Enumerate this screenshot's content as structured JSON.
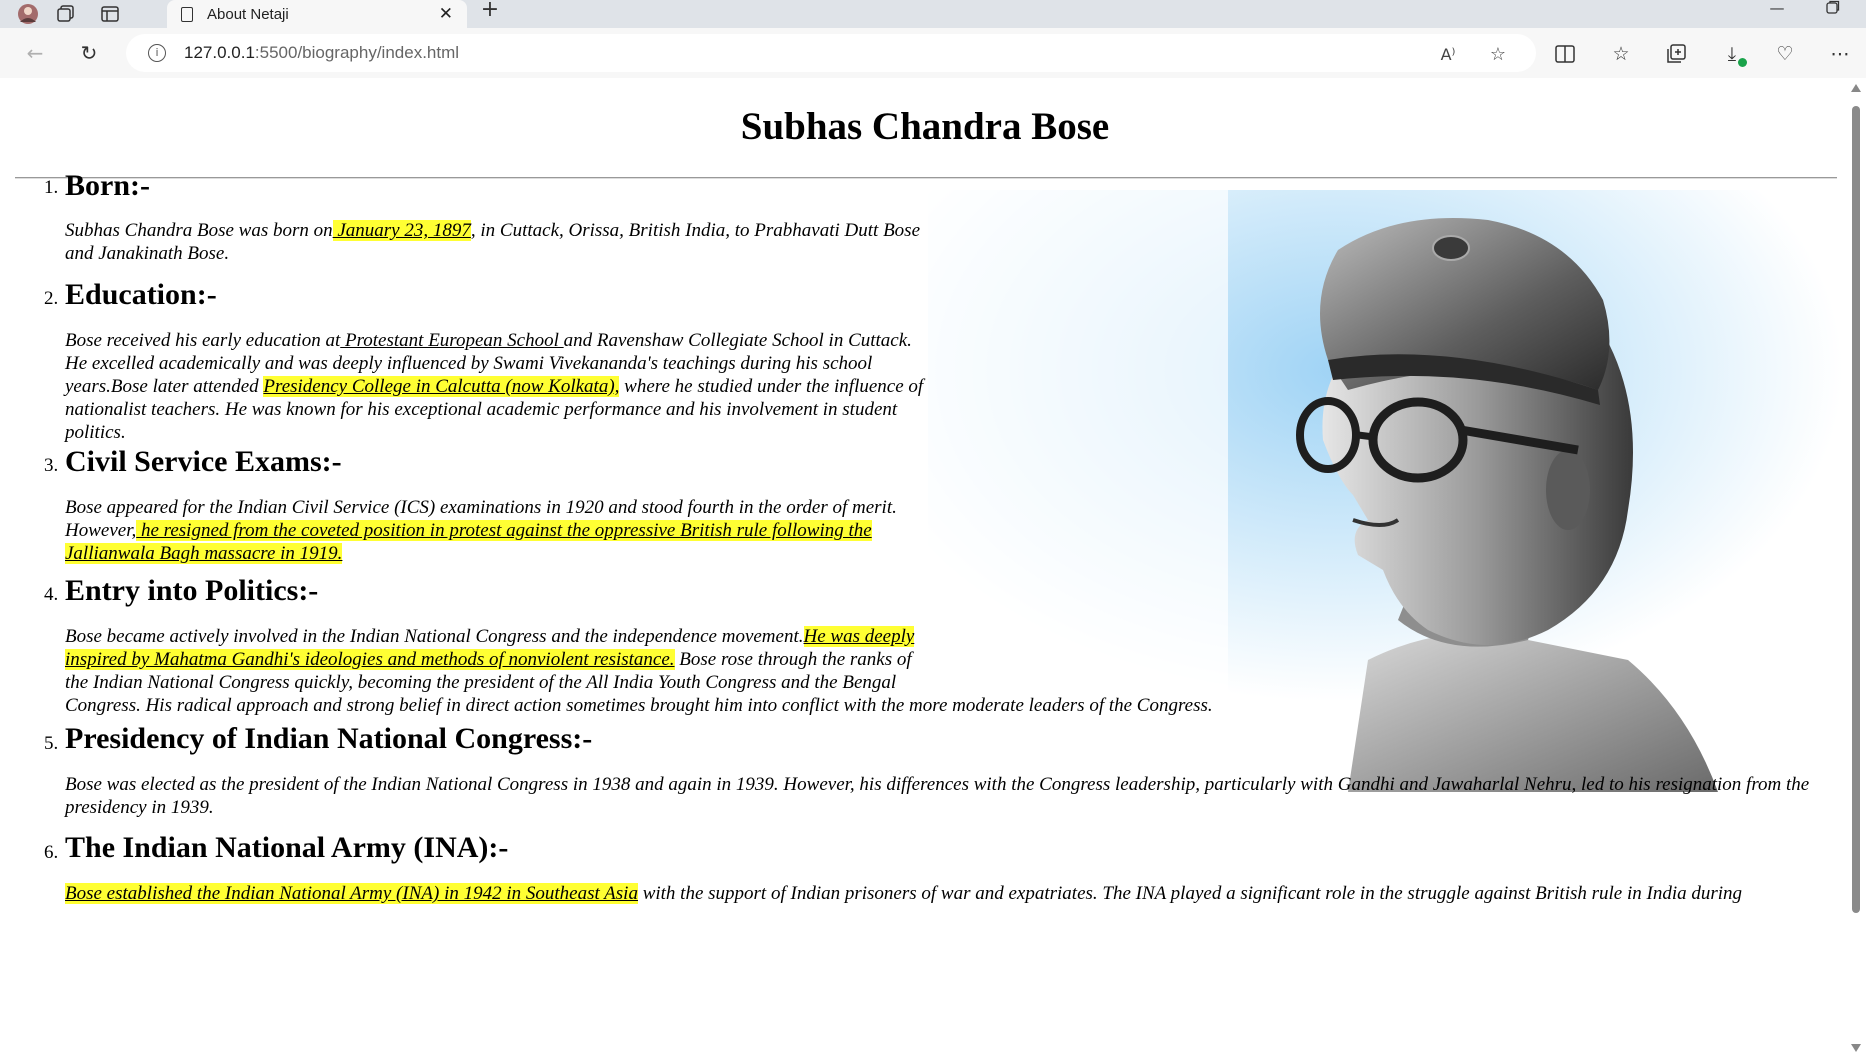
{
  "browser": {
    "tab_title": "About Netaji",
    "url_host": "127.0.0.1",
    "url_path": ":5500/biography/index.html",
    "read_aloud_label": "A⁾"
  },
  "page": {
    "title": "Subhas Chandra Bose",
    "sections": [
      {
        "number": "1.",
        "heading": "Born:-",
        "p1": "Subhas Chandra Bose was born on",
        "h1": " January 23, 1897",
        "p2": ", in Cuttack, Orissa, British India, to Prabhavati Dutt Bose and Janakinath Bose."
      },
      {
        "number": "2.",
        "heading": "Education:-",
        "p1": "Bose received his early education at",
        "u1": " Protestant European School ",
        "p2": "and Ravenshaw Collegiate School in Cuttack. He excelled academically and was deeply influenced by Swami Vivekananda's teachings during his school years.Bose later attended ",
        "h1": "Presidency College in Calcutta (now Kolkata),",
        "p3": " where he studied under the influence of nationalist teachers. He was known for his exceptional academic performance and his involvement in student politics."
      },
      {
        "number": "3.",
        "heading": "Civil Service Exams:-",
        "p1": "Bose appeared for the Indian Civil Service (ICS) examinations in 1920 and stood fourth in the order of merit. However,",
        "h1": " he resigned from the coveted position in protest against the oppressive British rule following the Jallianwala Bagh massacre in 1919."
      },
      {
        "number": "4.",
        "heading": "Entry into Politics:-",
        "p1": "Bose became actively involved in the Indian National Congress and the independence movement.",
        "h1": "He was deeply inspired by Mahatma Gandhi's ideologies and methods of nonviolent resistance.",
        "p2": " Bose rose through the ranks of the Indian National Congress quickly, becoming the president of the All India Youth Congress and the Bengal Congress. His radical approach and strong belief in direct action sometimes brought him into conflict with the more moderate leaders of the Congress."
      },
      {
        "number": "5.",
        "heading": "Presidency of Indian National Congress:-",
        "p1": "Bose was elected as the president of the Indian National Congress in 1938 and again in 1939. However, his differences with the Congress leadership, particularly with Gandhi and Jawaharlal Nehru, led to his resignation from the presidency in 1939."
      },
      {
        "number": "6.",
        "heading": "The Indian National Army (INA):-",
        "h1": "Bose established the Indian National Army (INA) in 1942 in Southeast Asia",
        "p1": " with the support of Indian prisoners of war and expatriates. The INA played a significant role in the struggle against British rule in India during"
      }
    ]
  },
  "colors": {
    "highlight": "#ffff33",
    "tabbar": "#dfe3e8",
    "toolbar": "#f7f7f7"
  },
  "icons": [
    "profile-avatar-icon",
    "workspaces-icon",
    "tab-actions-icon",
    "document-icon",
    "close-icon",
    "plus-icon",
    "minimize-icon",
    "maximize-icon",
    "back-icon",
    "refresh-icon",
    "info-icon",
    "read-aloud-icon",
    "star-icon",
    "split-screen-icon",
    "favorites-icon",
    "collections-icon",
    "downloads-icon",
    "browser-essentials-icon",
    "more-icon"
  ]
}
